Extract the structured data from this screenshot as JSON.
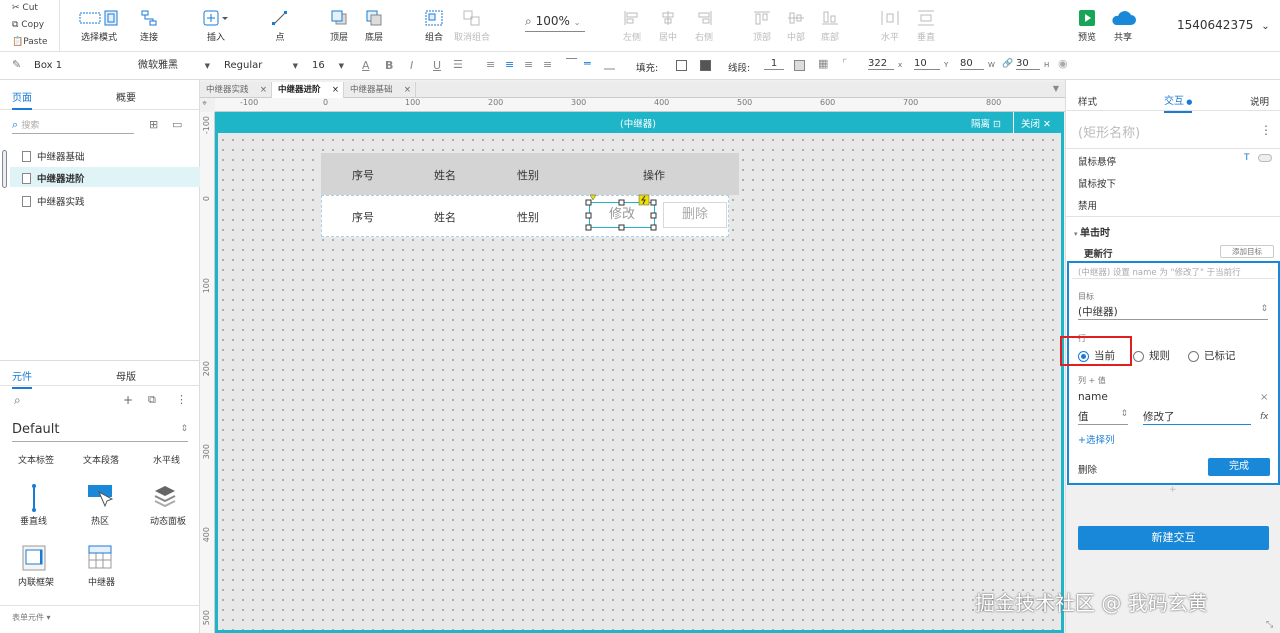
{
  "clipboard": {
    "cut": "Cut",
    "copy": "Copy",
    "paste": "Paste"
  },
  "toolbar": {
    "select_mode": "选择模式",
    "connect": "连接",
    "insert": "插入",
    "point": "点",
    "top_layer": "顶层",
    "bottom_layer": "底层",
    "group": "组合",
    "ungroup": "取消组合",
    "zoom": "100%",
    "align_left": "左侧",
    "align_center": "居中",
    "align_right": "右侧",
    "align_top": "顶部",
    "align_middle": "中部",
    "align_bottom": "底部",
    "dist_h": "水平",
    "dist_v": "垂直",
    "preview": "预览",
    "share": "共享",
    "account": "1540642375"
  },
  "format": {
    "element_name": "Box 1",
    "font_family": "微软雅黑",
    "font_weight": "Regular",
    "font_size": "16",
    "fill_label": "填充:",
    "stroke_label": "线段:",
    "stroke_value": "1",
    "x": "322",
    "x_label": "x",
    "y": "10",
    "y_label": "Y",
    "w": "80",
    "w_label": "W",
    "h": "30",
    "h_label": "H"
  },
  "left": {
    "tab_pages": "页面",
    "tab_outline": "概要",
    "search_placeholder": "搜索",
    "pages": [
      "中继器基础",
      "中继器进阶",
      "中继器实践"
    ],
    "tab_widgets": "元件",
    "tab_masters": "母版",
    "library": "Default",
    "widgets": [
      "文本标签",
      "文本段落",
      "水平线",
      "垂直线",
      "热区",
      "动态面板",
      "内联框架",
      "中继器"
    ],
    "form_widgets": "表单元件"
  },
  "doc_tabs": [
    "中继器实践",
    "中继器进阶",
    "中继器基础"
  ],
  "ruler_h": [
    "-100",
    "0",
    "100",
    "200",
    "300",
    "400",
    "500",
    "600",
    "700",
    "800"
  ],
  "ruler_v": [
    "-100",
    "0",
    "100",
    "200",
    "300",
    "400",
    "500"
  ],
  "frame": {
    "title": "(中继器)",
    "isolate": "隔离",
    "close": "关闭"
  },
  "table": {
    "headers": [
      "序号",
      "姓名",
      "性别",
      "操作"
    ],
    "row": [
      "序号",
      "姓名",
      "性别"
    ],
    "edit": "修改",
    "delete": "删除"
  },
  "right": {
    "tab_style": "样式",
    "tab_interaction": "交互",
    "tab_notes": "说明",
    "shape_name_placeholder": "(矩形名称)",
    "states": [
      "鼠标悬停",
      "鼠标按下",
      "禁用"
    ],
    "hover_marker": "T",
    "event": "单击时",
    "action": "更新行",
    "add_target": "添加目标",
    "summary": "(中继器) 设置 name 为 \"修改了\" 于当前行",
    "target_label": "目标",
    "target_value": "(中继器)",
    "row_label": "行",
    "row_options": [
      "当前",
      "规则",
      "已标记"
    ],
    "col_value_label": "列 + 值",
    "col_name": "name",
    "value_type": "值",
    "value": "修改了",
    "fx": "fx",
    "add_column": "+选择列",
    "delete": "删除",
    "done": "完成",
    "new_interaction": "新建交互"
  },
  "watermark": "掘金技术社区 @ 我码玄黄",
  "colors": {
    "accent": "#1a7bd6",
    "frame": "#1fb5c9",
    "highlight": "#e02020"
  }
}
